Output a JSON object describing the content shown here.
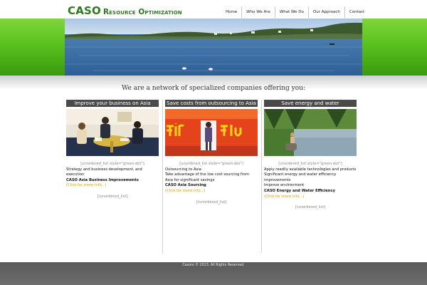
{
  "header": {
    "logo_main": "CASO",
    "logo_rest": "Resource Optimization",
    "nav": [
      "Home",
      "Who We Are",
      "What We Do",
      "Our Approach",
      "Contact"
    ]
  },
  "tagline": "We are a network of specialized companies offering you:",
  "columns": [
    {
      "title": "Improve your business on Asia",
      "meta": "[unordered_list style=\"green-dot\"]",
      "lines": [
        "Strategy and business development, and execution"
      ],
      "highlight": "CASO Asia Business Improvements",
      "more": "(Click for more info...)",
      "foot": "[/unordered_list]"
    },
    {
      "title": "Save costs from outsourcing to Asia",
      "meta": "[unordered_list style=\"green-dot\"]",
      "lines": [
        "Outsourcing to Asia",
        "Take advantage of the low cost sourcing from Asia for significant savings"
      ],
      "highlight": "CASO Asia Sourcing",
      "more": "(Click for more info...)",
      "foot": "[/unordered_list]"
    },
    {
      "title": "Save energy and water",
      "meta": "[unordered_list style=\"green-dot\"]",
      "lines": [
        "Apply readily available technologies and products",
        "Significant energy and water efficiency improvements",
        "Improve environment"
      ],
      "highlight": "CASO Energy and Water Efficiency",
      "more": "(Click for more info...)",
      "foot": "[/unordered_list]"
    }
  ],
  "footer": "Casoro © 2013. All Rights Reserved.",
  "colors": {
    "brand_green": "#2d7a1f",
    "accent_green": "#59c21f",
    "link_orange": "#d89a1e",
    "header_gray": "#4a4a4a"
  }
}
